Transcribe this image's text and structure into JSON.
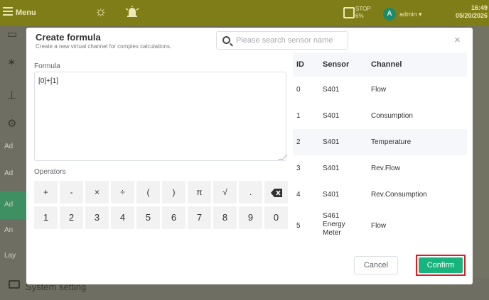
{
  "topbar": {
    "menu_label": "Menu",
    "stop_label": "STOP",
    "stop_percent": "6%",
    "avatar_letter": "A",
    "user_name": "admin",
    "time": "16:49",
    "date": "05/20/2026"
  },
  "sidebar": {
    "items": [
      "Ad",
      "Ad",
      "Ad",
      "An",
      "Lay"
    ]
  },
  "bottom": {
    "system_setting": "System setting"
  },
  "modal": {
    "title": "Create formula",
    "subtitle": "Create a new virtual channel for complex calculations.",
    "search_placeholder": "Please search sensor name",
    "close_symbol": "×",
    "formula_label": "Formula",
    "formula_value": "[0]+[1]",
    "operators_label": "Operators",
    "operators": [
      "+",
      "-",
      "×",
      "÷",
      "(",
      ")",
      "π",
      "√",
      ".",
      "⌫"
    ],
    "digits": [
      "1",
      "2",
      "3",
      "4",
      "5",
      "6",
      "7",
      "8",
      "9",
      "0"
    ],
    "table": {
      "headers": {
        "id": "ID",
        "sensor": "Sensor",
        "channel": "Channel"
      },
      "rows": [
        {
          "id": "0",
          "sensor": "S401",
          "channel": "Flow"
        },
        {
          "id": "1",
          "sensor": "S401",
          "channel": "Consumption"
        },
        {
          "id": "2",
          "sensor": "S401",
          "channel": "Temperature"
        },
        {
          "id": "3",
          "sensor": "S401",
          "channel": "Rev.Flow"
        },
        {
          "id": "4",
          "sensor": "S401",
          "channel": "Rev.Consumption"
        },
        {
          "id": "5",
          "sensor": "S461 Energy Meter",
          "channel": "Flow"
        }
      ]
    },
    "cancel_label": "Cancel",
    "confirm_label": "Confirm"
  }
}
